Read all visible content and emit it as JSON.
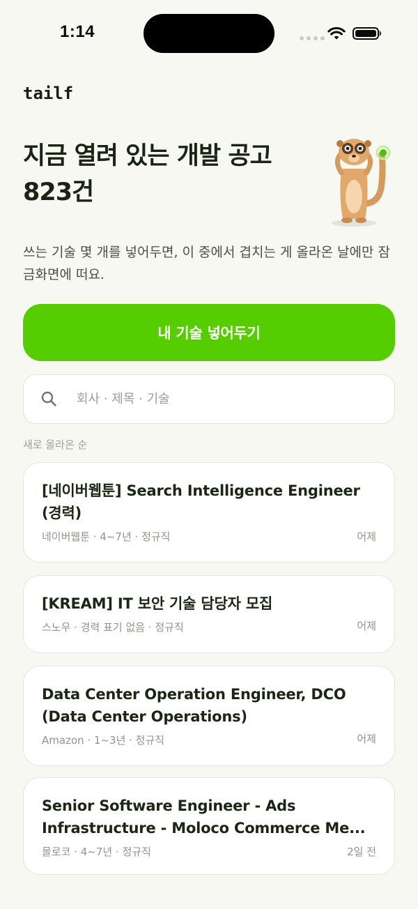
{
  "status_bar": {
    "time": "1:14"
  },
  "app": {
    "logo": "tailf"
  },
  "hero": {
    "headline": "지금 열려 있는 개발 공고",
    "count": "823건",
    "description": "쓰는 기술 몇 개를 넣어두면, 이 중에서 겹치는 게 올라온 날에만 잠금화면에 떠요.",
    "mascot_icon": "meerkat-mascot-icon"
  },
  "cta": {
    "label": "내 기술 넣어두기"
  },
  "search": {
    "placeholder": "회사 · 제목 · 기술",
    "value": ""
  },
  "sort": {
    "label": "새로 올라온 순"
  },
  "jobs": [
    {
      "title": "[네이버웹툰] Search Intelligence Engineer (경력)",
      "meta": "네이버웹툰 · 4~7년 · 정규직",
      "date": "어제"
    },
    {
      "title": "[KREAM] IT 보안 기술 담당자 모집",
      "meta": "스노우 · 경력 표기 없음 · 정규직",
      "date": "어제"
    },
    {
      "title": "Data Center Operation Engineer, DCO (Data Center Operations)",
      "meta": "Amazon · 1~3년 · 정규직",
      "date": "어제"
    },
    {
      "title": "Senior Software Engineer - Ads Infrastructure - Moloco Commerce Me...",
      "meta": "몰로코 · 4~7년 · 정규직",
      "date": "2일 전"
    }
  ],
  "colors": {
    "background": "#f6f8f1",
    "accent": "#56cd00",
    "text_primary": "#1b2614",
    "text_secondary": "#8f948a"
  }
}
